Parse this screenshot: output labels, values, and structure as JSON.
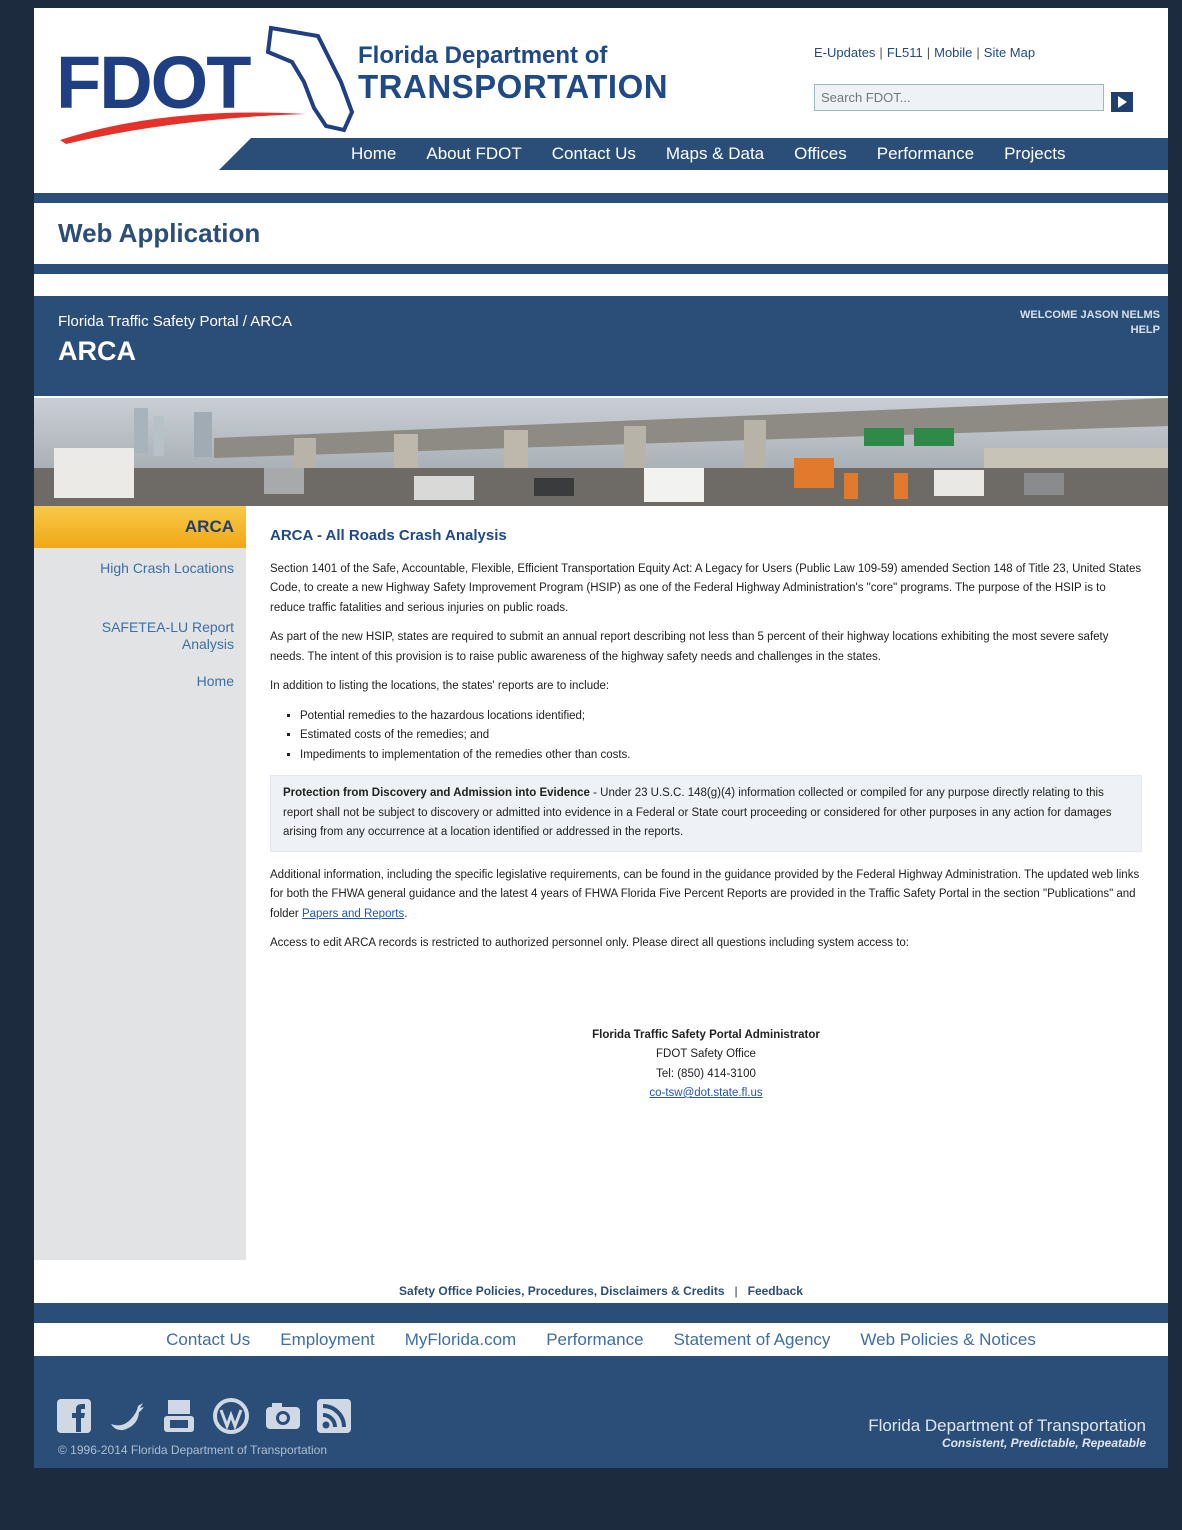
{
  "header": {
    "logo_text": "FDOT",
    "agency_line1": "Florida Department of",
    "agency_line2": "TRANSPORTATION",
    "util_links": [
      "E-Updates",
      "FL511",
      "Mobile",
      "Site Map"
    ],
    "search_placeholder": "Search FDOT...",
    "nav": [
      "Home",
      "About FDOT",
      "Contact Us",
      "Maps & Data",
      "Offices",
      "Performance",
      "Projects"
    ]
  },
  "page_title": "Web Application",
  "app": {
    "breadcrumb": "Florida Traffic Safety Portal / ARCA",
    "title": "ARCA",
    "welcome": "WELCOME JASON NELMS",
    "help": "HELP"
  },
  "sidebar": {
    "heading": "ARCA",
    "items": [
      "High Crash Locations",
      "SAFETEA-LU Report Analysis",
      "Home"
    ]
  },
  "main": {
    "heading": "ARCA - All Roads Crash Analysis",
    "p1": "Section 1401 of the Safe, Accountable, Flexible, Efficient Transportation Equity Act: A Legacy for Users (Public Law 109-59) amended Section 148 of Title 23, United States Code, to create a new Highway Safety Improvement Program (HSIP) as one of the Federal Highway Administration's \"core\" programs. The purpose of the HSIP is to reduce traffic fatalities and serious injuries on public roads.",
    "p2": "As part of the new HSIP, states are required to submit an annual report describing not less than 5 percent of their highway locations exhibiting the most severe safety needs. The intent of this provision is to raise public awareness of the highway safety needs and challenges in the states.",
    "p3": "In addition to listing the locations, the states' reports are to include:",
    "bullets": [
      "Potential remedies to the hazardous locations identified;",
      "Estimated costs of the remedies; and",
      "Impediments to implementation of the remedies other than costs."
    ],
    "note_bold": "Protection from Discovery and Admission into Evidence",
    "note_text": " - Under 23 U.S.C. 148(g)(4) information collected or compiled for any purpose directly relating to this report shall not be subject to discovery or admitted into evidence in a Federal or State court proceeding or considered for other purposes in any action for damages arising from any occurrence at a location identified or addressed in the reports.",
    "p4": "Additional information, including the specific legislative requirements, can be found in the guidance provided by the Federal Highway Administration. The updated web links for both the FHWA general guidance and the latest 4 years of FHWA Florida Five Percent Reports are provided in the Traffic Safety Portal in the section \"Publications\" and folder ",
    "p4_link": "Papers and Reports",
    "p4_end": ".",
    "p5": "Access to edit ARCA records is restricted to authorized personnel only. Please direct all questions including system access to:",
    "contact": {
      "name": "Florida Traffic Safety Portal Administrator",
      "office": "FDOT Safety Office",
      "tel": "Tel: (850) 414-3100",
      "email": "co-tsw@dot.state.fl.us"
    }
  },
  "footer": {
    "policy_link": "Safety Office Policies, Procedures, Disclaimers & Credits",
    "feedback_link": "Feedback",
    "nav": [
      "Contact Us",
      "Employment",
      "MyFlorida.com",
      "Performance",
      "Statement of Agency",
      "Web Policies & Notices"
    ],
    "social_icons": [
      "facebook-icon",
      "twitter-icon",
      "youtube-icon",
      "wordpress-icon",
      "flickr-icon",
      "rss-icon"
    ],
    "copyright": "© 1996-2014 Florida Department of Transportation",
    "org_name": "Florida Department of Transportation",
    "tagline": "Consistent, Predictable, Repeatable"
  },
  "colors": {
    "navy": "#2b4e79",
    "outer": "#1d2b3f",
    "accent_yellow": "#f0a816",
    "link": "#3d6ea5"
  }
}
